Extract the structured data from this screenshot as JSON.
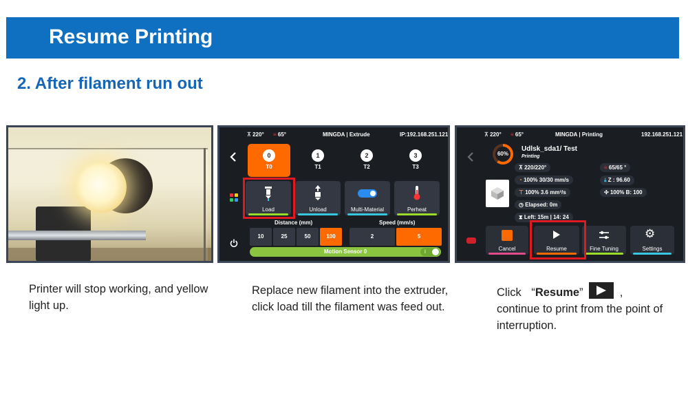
{
  "banner": {
    "title": "Resume Printing"
  },
  "section": {
    "title": "2. After filament run out"
  },
  "panel2": {
    "topbar": {
      "nozzle": "220°",
      "bed": "65°",
      "title": "MINGDA | Extrude",
      "ip": "IP:192.168.251.121"
    },
    "tools": [
      {
        "icon": "0",
        "label": "T0"
      },
      {
        "icon": "1",
        "label": "T1"
      },
      {
        "icon": "2",
        "label": "T2"
      },
      {
        "icon": "3",
        "label": "T3"
      }
    ],
    "tiles": [
      {
        "label": "Load",
        "color": "#9bdc2a"
      },
      {
        "label": "Unload",
        "color": "#37c8e0"
      },
      {
        "label": "Multi-Material",
        "color": "#37c8e0"
      },
      {
        "label": "Perheat",
        "color": "#9bdc2a"
      }
    ],
    "distance_label": "Distance (mm)",
    "speed_label": "Speed (mm/s)",
    "distances": [
      "10",
      "25",
      "50",
      "100"
    ],
    "speeds": [
      "2",
      "5"
    ],
    "sensor": "Motion Sensor 0",
    "toggle_glyph": "i"
  },
  "panel3": {
    "topbar": {
      "nozzle": "220°",
      "bed": "65°",
      "title": "MINGDA | Printing",
      "ip": "192.168.251.121"
    },
    "progress": "60%",
    "file": "Udlsk_sda1/ Test",
    "state": "Printing",
    "temp": "220/220°",
    "speed": "100% 30/30 mm/s",
    "flow": "100%  3.6 mm³/s",
    "elapsed": "Elapsed: 0m",
    "left": "Left: 15m | 14: 24",
    "bed": "65/65 °",
    "z": "Z : 96.60",
    "fan": "100% B: 100",
    "buttons": [
      {
        "label": "Cancel",
        "color": "#e24b8b"
      },
      {
        "label": "Resume",
        "color": "#ff6a00"
      },
      {
        "label": "Fine Tuning",
        "color": "#9bdc2a"
      },
      {
        "label": "Settings",
        "color": "#37c8e0"
      }
    ]
  },
  "captions": {
    "one": "Printer will stop working, and yellow light up.",
    "two": "Replace new filament into the extruder, click load till the filament was feed out.",
    "three_click": "Click",
    "three_open_quote": "“",
    "three_bold": "Resume",
    "three_close_quote": "”",
    "three_comma": ",",
    "three_rest": "continue to print from the point of interruption."
  },
  "colors": {
    "brand": "#0f6fc0",
    "accent": "#ff6a00",
    "highlight": "#e01a22"
  }
}
